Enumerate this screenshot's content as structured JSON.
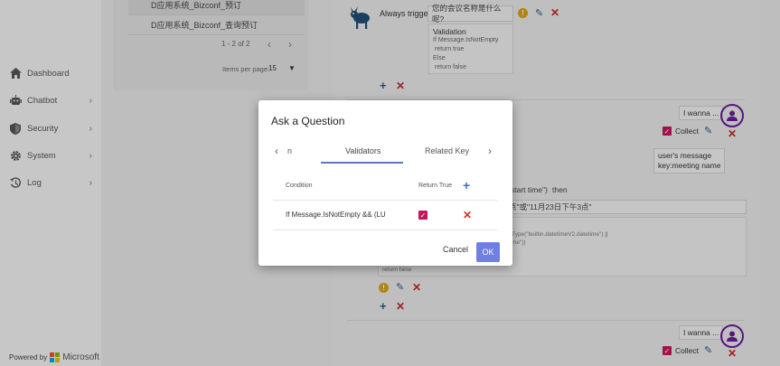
{
  "sidebar": {
    "items": [
      {
        "label": "Dashboard",
        "icon": "home-icon",
        "has_chevron": false
      },
      {
        "label": "Chatbot",
        "icon": "robot-icon",
        "has_chevron": true
      },
      {
        "label": "Security",
        "icon": "shield-icon",
        "has_chevron": true
      },
      {
        "label": "System",
        "icon": "gear-icon",
        "has_chevron": true
      },
      {
        "label": "Log",
        "icon": "history-icon",
        "has_chevron": true
      }
    ],
    "powered_by": "Powered by",
    "brand": "Microsoft"
  },
  "list_panel": {
    "rows": [
      "D应用系统_Bizconf_预订",
      "D应用系统_Bizconf_查询预订"
    ],
    "pager_text": "1 - 2 of 2",
    "items_per_page_label": "Items per page:",
    "items_per_page_value": "15"
  },
  "flow": {
    "trigger_label": "Always trigger",
    "trigger_prompt": "您的会议名称是什么呢?",
    "validation": {
      "title": "Validation",
      "lines": [
        "If Message.IsNotEmpty",
        " return true",
        "Else",
        " return false"
      ]
    },
    "user_message_1": "I wanna ...",
    "collect_label": "Collect",
    "user_msg_key": [
      "user's message",
      "key:meeting name"
    ],
    "partial_condition": "start time\")",
    "then_label": "then",
    "partial_prompt": "点\"或\"11月23日下午3点\"",
    "code_fragments": [
      "Type(\"builtin.datetimeV2.datetime\") ||",
      "me\"))"
    ],
    "return_false": "return false",
    "user_message_2": "I wanna ..."
  },
  "dialog": {
    "title": "Ask a Question",
    "tabs": [
      "n",
      "Validators",
      "Related Key"
    ],
    "active_tab": "Validators",
    "headers": {
      "condition": "Condition",
      "return_true": "Return True"
    },
    "rows": [
      {
        "condition": "If  Message.IsNotEmpty && (LU",
        "return_true": true
      }
    ],
    "cancel_label": "Cancel",
    "ok_label": "OK"
  },
  "colors": {
    "accent_blue": "#3f6ec3",
    "ok_button": "#6f7fe3",
    "check_pink": "#c2185b",
    "delete_red": "#d32f2f",
    "avatar_purple": "#6a1b9a"
  }
}
